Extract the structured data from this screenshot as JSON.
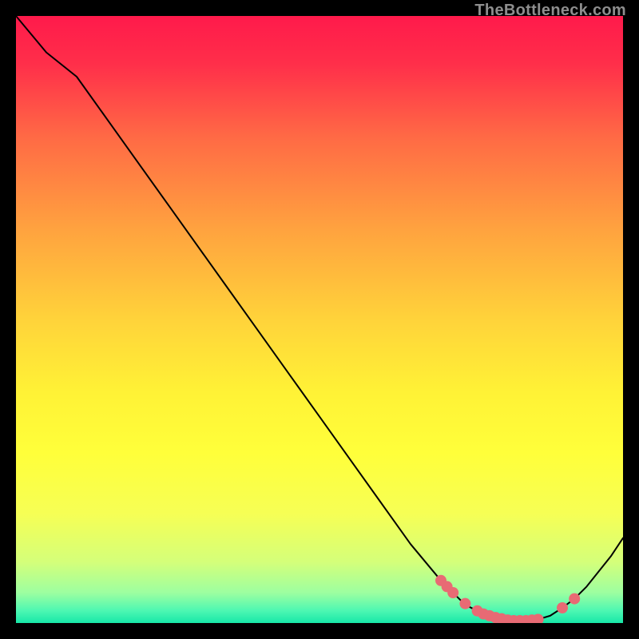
{
  "watermark": "TheBottleneck.com",
  "chart_data": {
    "type": "line",
    "title": "",
    "xlabel": "",
    "ylabel": "",
    "xlim": [
      0,
      100
    ],
    "ylim": [
      0,
      100
    ],
    "grid": false,
    "series": [
      {
        "name": "curve",
        "x": [
          0,
          5,
          10,
          15,
          20,
          25,
          30,
          35,
          40,
          45,
          50,
          55,
          60,
          65,
          70,
          72,
          74,
          76,
          78,
          80,
          82,
          84,
          86,
          88,
          90,
          92,
          94,
          96,
          98,
          100
        ],
        "y": [
          100,
          94,
          90,
          83,
          76,
          69,
          62,
          55,
          48,
          41,
          34,
          27,
          20,
          13,
          7,
          5,
          3,
          2,
          1.2,
          0.6,
          0.4,
          0.4,
          0.6,
          1.2,
          2.5,
          4,
          6,
          8.5,
          11,
          14
        ],
        "stroke": "#000000",
        "stroke_width": 2
      }
    ],
    "markers": {
      "name": "valley-points",
      "points": [
        {
          "x": 70,
          "y": 7.0
        },
        {
          "x": 71,
          "y": 6.0
        },
        {
          "x": 72,
          "y": 5.0
        },
        {
          "x": 74,
          "y": 3.2
        },
        {
          "x": 76,
          "y": 2.0
        },
        {
          "x": 77,
          "y": 1.5
        },
        {
          "x": 78,
          "y": 1.2
        },
        {
          "x": 79,
          "y": 0.9
        },
        {
          "x": 80,
          "y": 0.7
        },
        {
          "x": 81,
          "y": 0.5
        },
        {
          "x": 82,
          "y": 0.4
        },
        {
          "x": 83,
          "y": 0.4
        },
        {
          "x": 84,
          "y": 0.4
        },
        {
          "x": 85,
          "y": 0.5
        },
        {
          "x": 86,
          "y": 0.6
        },
        {
          "x": 90,
          "y": 2.5
        },
        {
          "x": 92,
          "y": 4.0
        }
      ],
      "color": "#e86a74",
      "radius": 7
    },
    "background_gradient": [
      {
        "offset": 0.0,
        "color": "#ff1a4b"
      },
      {
        "offset": 0.08,
        "color": "#ff2f4a"
      },
      {
        "offset": 0.2,
        "color": "#ff6a45"
      },
      {
        "offset": 0.35,
        "color": "#ffa23f"
      },
      {
        "offset": 0.5,
        "color": "#ffd33a"
      },
      {
        "offset": 0.62,
        "color": "#fff236"
      },
      {
        "offset": 0.72,
        "color": "#ffff3a"
      },
      {
        "offset": 0.82,
        "color": "#f6ff55"
      },
      {
        "offset": 0.9,
        "color": "#d4ff7a"
      },
      {
        "offset": 0.95,
        "color": "#9dffa0"
      },
      {
        "offset": 0.98,
        "color": "#4cf7b2"
      },
      {
        "offset": 1.0,
        "color": "#17e7a8"
      }
    ]
  }
}
